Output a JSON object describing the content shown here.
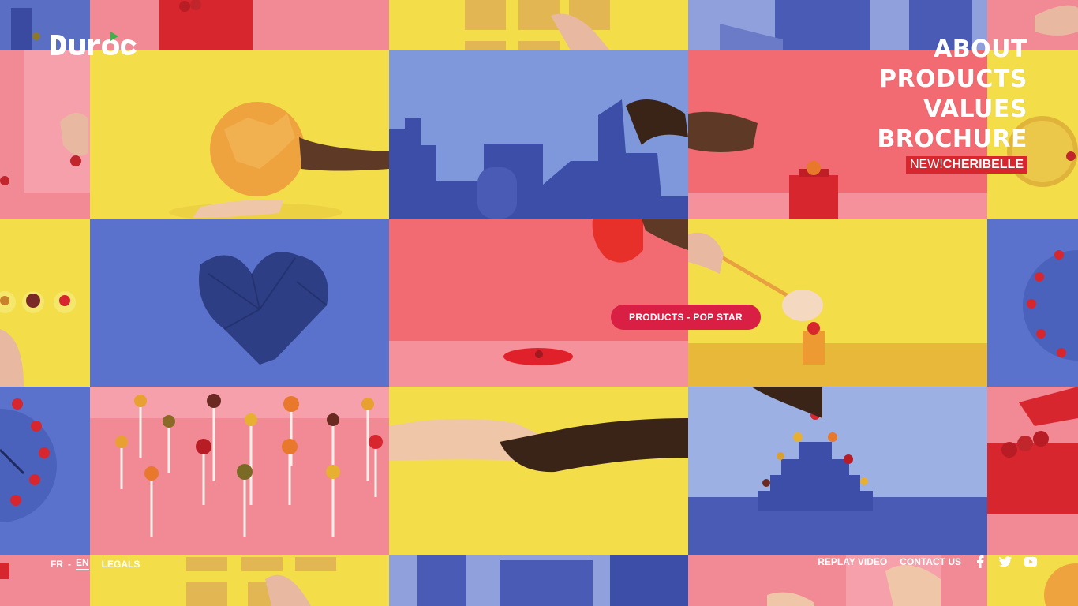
{
  "brand": {
    "logo_text": "duroc"
  },
  "nav": {
    "items": [
      "ABOUT",
      "PRODUCTS",
      "VALUES",
      "BROCHURE"
    ],
    "new_prefix": "NEW!",
    "new_product": "CHERIBELLE"
  },
  "hover_label": "PRODUCTS - POP STAR",
  "footer": {
    "lang_fr": "FR",
    "lang_sep": "-",
    "lang_en": "EN",
    "legals": "LEGALS",
    "replay": "REPLAY VIDEO",
    "contact": "CONTACT US",
    "social_icons": [
      "facebook-icon",
      "twitter-icon",
      "youtube-icon"
    ]
  },
  "colors": {
    "yellow": "#f3de4a",
    "blue": "#5a6fc3",
    "pink": "#f07a86",
    "red": "#d8262e",
    "pill": "#d91f43"
  }
}
